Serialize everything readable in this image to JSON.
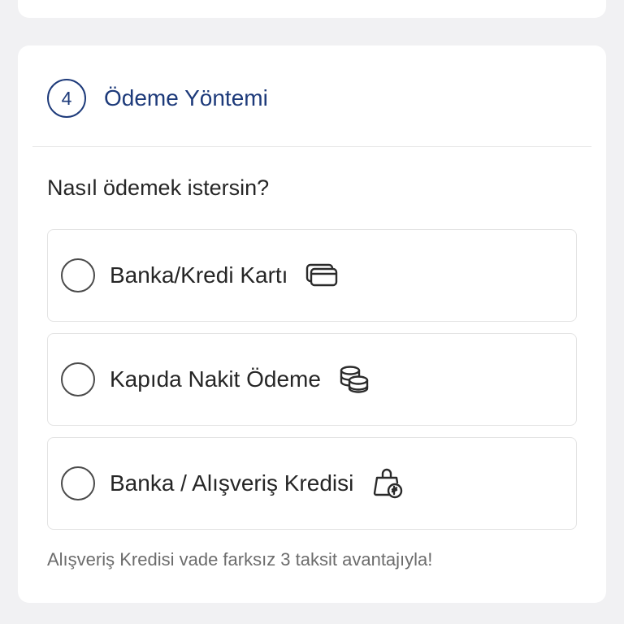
{
  "step": {
    "number": "4",
    "title": "Ödeme Yöntemi"
  },
  "question": "Nasıl ödemek istersin?",
  "options": [
    {
      "label": "Banka/Kredi Kartı",
      "icon": "credit-card-icon",
      "selected": false
    },
    {
      "label": "Kapıda Nakit Ödeme",
      "icon": "coins-icon",
      "selected": false
    },
    {
      "label": "Banka / Alışveriş Kredisi",
      "icon": "shopping-bag-lira-icon",
      "selected": false
    }
  ],
  "note": "Alışveriş Kredisi vade farksız 3 taksit avantajıyla!",
  "colors": {
    "accent": "#1d3a7a",
    "text": "#262626",
    "muted": "#6c6c6c",
    "border": "#e3e3e3",
    "background": "#f1f1f3"
  }
}
